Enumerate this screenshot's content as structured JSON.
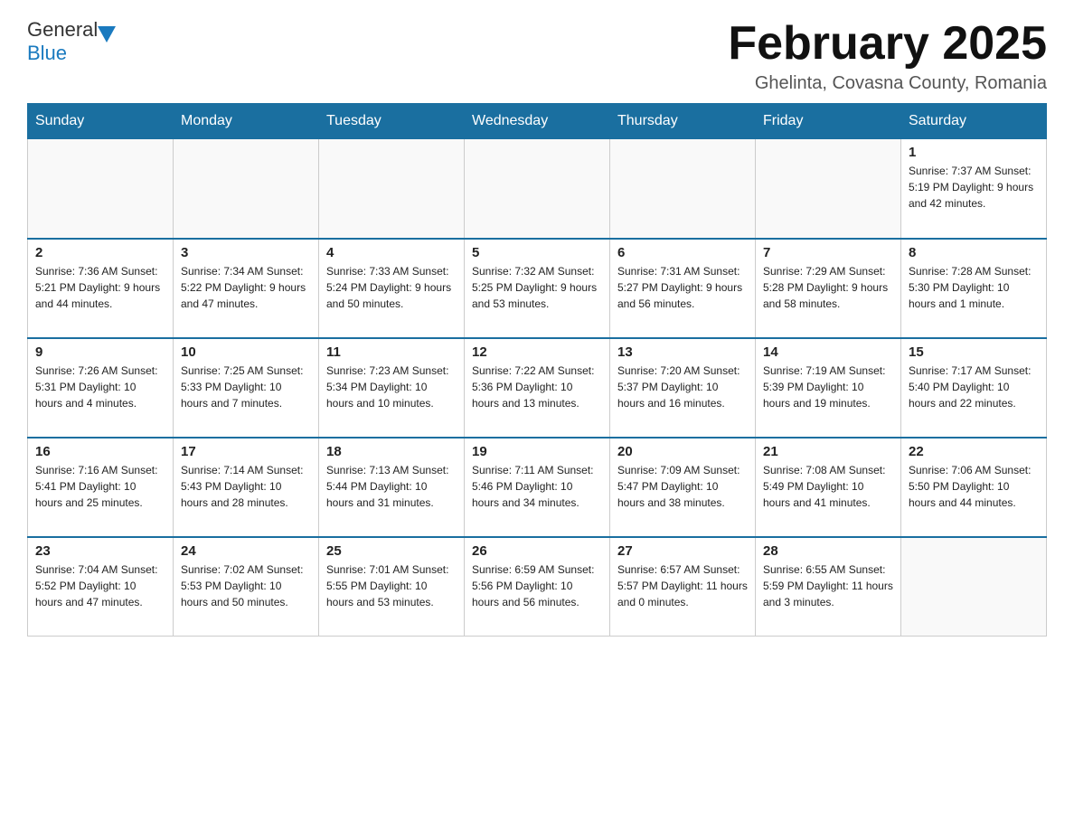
{
  "header": {
    "logo_general": "General",
    "logo_blue": "Blue",
    "title": "February 2025",
    "subtitle": "Ghelinta, Covasna County, Romania"
  },
  "days_of_week": [
    "Sunday",
    "Monday",
    "Tuesday",
    "Wednesday",
    "Thursday",
    "Friday",
    "Saturday"
  ],
  "weeks": [
    [
      {
        "day": "",
        "info": "",
        "empty": true
      },
      {
        "day": "",
        "info": "",
        "empty": true
      },
      {
        "day": "",
        "info": "",
        "empty": true
      },
      {
        "day": "",
        "info": "",
        "empty": true
      },
      {
        "day": "",
        "info": "",
        "empty": true
      },
      {
        "day": "",
        "info": "",
        "empty": true
      },
      {
        "day": "1",
        "info": "Sunrise: 7:37 AM\nSunset: 5:19 PM\nDaylight: 9 hours\nand 42 minutes."
      }
    ],
    [
      {
        "day": "2",
        "info": "Sunrise: 7:36 AM\nSunset: 5:21 PM\nDaylight: 9 hours\nand 44 minutes."
      },
      {
        "day": "3",
        "info": "Sunrise: 7:34 AM\nSunset: 5:22 PM\nDaylight: 9 hours\nand 47 minutes."
      },
      {
        "day": "4",
        "info": "Sunrise: 7:33 AM\nSunset: 5:24 PM\nDaylight: 9 hours\nand 50 minutes."
      },
      {
        "day": "5",
        "info": "Sunrise: 7:32 AM\nSunset: 5:25 PM\nDaylight: 9 hours\nand 53 minutes."
      },
      {
        "day": "6",
        "info": "Sunrise: 7:31 AM\nSunset: 5:27 PM\nDaylight: 9 hours\nand 56 minutes."
      },
      {
        "day": "7",
        "info": "Sunrise: 7:29 AM\nSunset: 5:28 PM\nDaylight: 9 hours\nand 58 minutes."
      },
      {
        "day": "8",
        "info": "Sunrise: 7:28 AM\nSunset: 5:30 PM\nDaylight: 10 hours\nand 1 minute."
      }
    ],
    [
      {
        "day": "9",
        "info": "Sunrise: 7:26 AM\nSunset: 5:31 PM\nDaylight: 10 hours\nand 4 minutes."
      },
      {
        "day": "10",
        "info": "Sunrise: 7:25 AM\nSunset: 5:33 PM\nDaylight: 10 hours\nand 7 minutes."
      },
      {
        "day": "11",
        "info": "Sunrise: 7:23 AM\nSunset: 5:34 PM\nDaylight: 10 hours\nand 10 minutes."
      },
      {
        "day": "12",
        "info": "Sunrise: 7:22 AM\nSunset: 5:36 PM\nDaylight: 10 hours\nand 13 minutes."
      },
      {
        "day": "13",
        "info": "Sunrise: 7:20 AM\nSunset: 5:37 PM\nDaylight: 10 hours\nand 16 minutes."
      },
      {
        "day": "14",
        "info": "Sunrise: 7:19 AM\nSunset: 5:39 PM\nDaylight: 10 hours\nand 19 minutes."
      },
      {
        "day": "15",
        "info": "Sunrise: 7:17 AM\nSunset: 5:40 PM\nDaylight: 10 hours\nand 22 minutes."
      }
    ],
    [
      {
        "day": "16",
        "info": "Sunrise: 7:16 AM\nSunset: 5:41 PM\nDaylight: 10 hours\nand 25 minutes."
      },
      {
        "day": "17",
        "info": "Sunrise: 7:14 AM\nSunset: 5:43 PM\nDaylight: 10 hours\nand 28 minutes."
      },
      {
        "day": "18",
        "info": "Sunrise: 7:13 AM\nSunset: 5:44 PM\nDaylight: 10 hours\nand 31 minutes."
      },
      {
        "day": "19",
        "info": "Sunrise: 7:11 AM\nSunset: 5:46 PM\nDaylight: 10 hours\nand 34 minutes."
      },
      {
        "day": "20",
        "info": "Sunrise: 7:09 AM\nSunset: 5:47 PM\nDaylight: 10 hours\nand 38 minutes."
      },
      {
        "day": "21",
        "info": "Sunrise: 7:08 AM\nSunset: 5:49 PM\nDaylight: 10 hours\nand 41 minutes."
      },
      {
        "day": "22",
        "info": "Sunrise: 7:06 AM\nSunset: 5:50 PM\nDaylight: 10 hours\nand 44 minutes."
      }
    ],
    [
      {
        "day": "23",
        "info": "Sunrise: 7:04 AM\nSunset: 5:52 PM\nDaylight: 10 hours\nand 47 minutes."
      },
      {
        "day": "24",
        "info": "Sunrise: 7:02 AM\nSunset: 5:53 PM\nDaylight: 10 hours\nand 50 minutes."
      },
      {
        "day": "25",
        "info": "Sunrise: 7:01 AM\nSunset: 5:55 PM\nDaylight: 10 hours\nand 53 minutes."
      },
      {
        "day": "26",
        "info": "Sunrise: 6:59 AM\nSunset: 5:56 PM\nDaylight: 10 hours\nand 56 minutes."
      },
      {
        "day": "27",
        "info": "Sunrise: 6:57 AM\nSunset: 5:57 PM\nDaylight: 11 hours\nand 0 minutes."
      },
      {
        "day": "28",
        "info": "Sunrise: 6:55 AM\nSunset: 5:59 PM\nDaylight: 11 hours\nand 3 minutes."
      },
      {
        "day": "",
        "info": "",
        "empty": true
      }
    ]
  ]
}
